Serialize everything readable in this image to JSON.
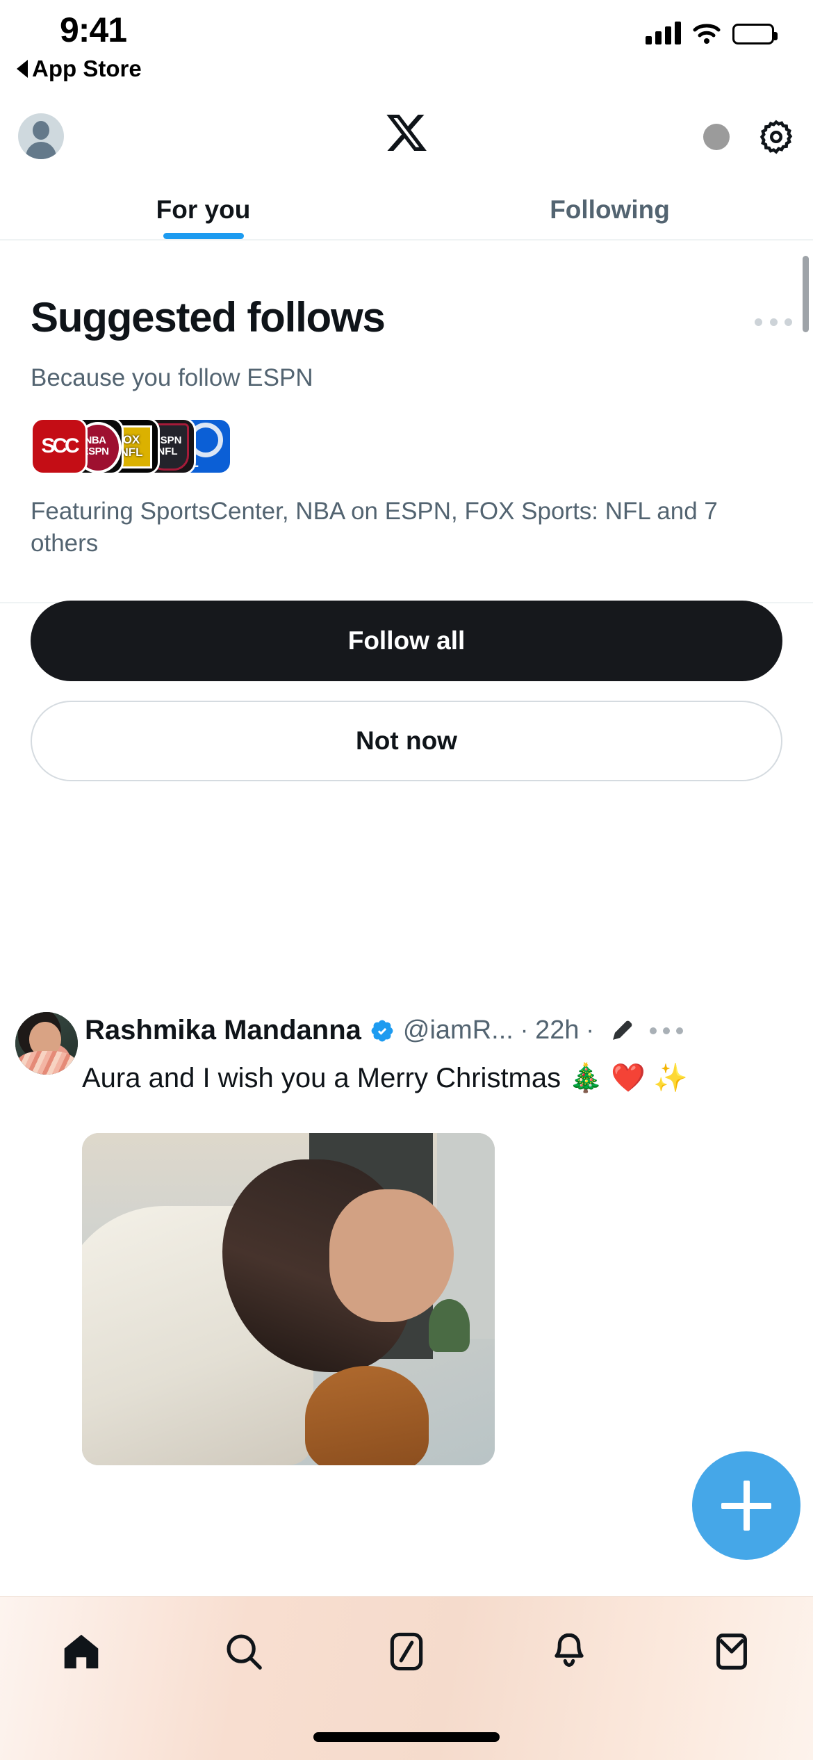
{
  "status_bar": {
    "time": "9:41",
    "back_label": "App Store",
    "icons": [
      "cellular-signal-icon",
      "wifi-icon",
      "battery-icon"
    ]
  },
  "top_bar": {
    "avatar_label": "Profile",
    "logo": "x-logo",
    "grok_label": "Grok",
    "settings_label": "Settings"
  },
  "tabs": [
    {
      "label": "For you",
      "active": true
    },
    {
      "label": "Following",
      "active": false
    }
  ],
  "suggested_follows": {
    "title": "Suggested follows",
    "subtitle": "Because you follow ESPN",
    "featuring": "Featuring SportsCenter, NBA on ESPN, FOX Sports: NFL and 7 others",
    "avatars": [
      {
        "name": "SportsCenter",
        "mark": "SC",
        "bg": "#c40d15"
      },
      {
        "name": "NBA on ESPN",
        "mark": "NBA ESPN",
        "bg": "#0a0a0a"
      },
      {
        "name": "FOX Sports: NFL",
        "mark": "FOX NFL",
        "bg": "#050505"
      },
      {
        "name": "ESPN NFL",
        "mark": "ESPN NFL",
        "bg": "#171417"
      },
      {
        "name": "NFL",
        "mark": "NFL",
        "bg": "#0b5fd6"
      }
    ],
    "follow_all_label": "Follow all",
    "not_now_label": "Not now",
    "more_label": "More"
  },
  "tweet": {
    "display_name": "Rashmika Mandanna",
    "verified": true,
    "handle": "@iamR...",
    "separator": "·",
    "timestamp": "22h",
    "text": "Aura and I wish you a Merry Christmas 🎄 ❤️ ✨",
    "more_label": "More"
  },
  "compose": {
    "label": "+",
    "color": "#45a7e8"
  },
  "bottom_nav": [
    {
      "name": "home",
      "active": true
    },
    {
      "name": "search",
      "active": false
    },
    {
      "name": "grok",
      "active": false
    },
    {
      "name": "notifications",
      "active": false
    },
    {
      "name": "messages",
      "active": false
    }
  ],
  "colors": {
    "accent_blue": "#1d9bf0",
    "verified_blue": "#1d9bf0",
    "text_primary": "#0f1419",
    "text_secondary": "#536471",
    "button_dark": "#16181c"
  }
}
